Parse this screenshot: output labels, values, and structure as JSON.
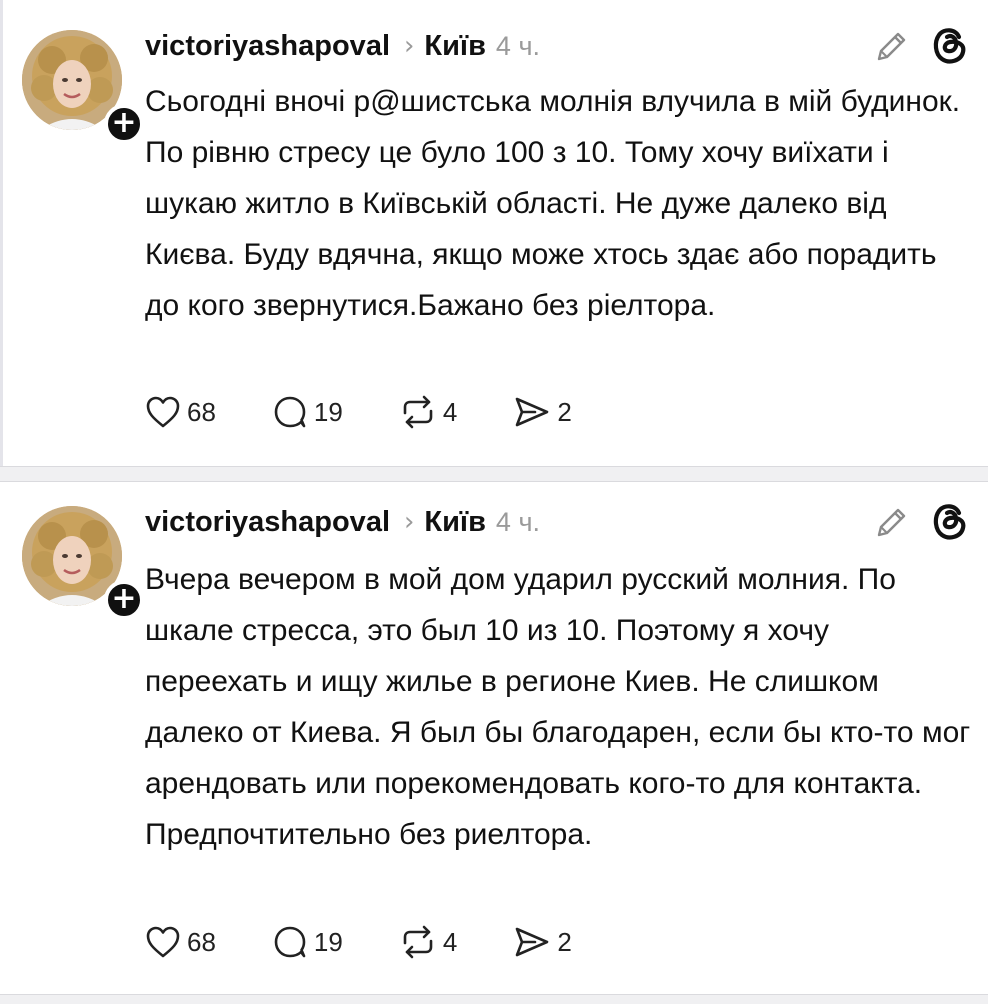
{
  "colors": {
    "text": "#111111",
    "muted": "#9a9a9a",
    "badge": "#101010",
    "separator": "#f0f0f2"
  },
  "posts": [
    {
      "username": "victoriyashapoval",
      "separator_icon": "chevron-right-icon",
      "location": "Київ",
      "time": "4 ч.",
      "text": "Сьогодні вночі р@шистська молнія влучила в мій будинок. По рівню стресу це було 100 з 10. Тому хочу виїхати і шукаю житло в Київській області. Не дуже далеко від Києва. Буду вдячна, якщо може хтось здає або порадить до кого звернутися.Бажано без ріелтора.",
      "badge": "+",
      "actions": {
        "likes": "68",
        "comments": "19",
        "reposts": "4",
        "shares": "2"
      }
    },
    {
      "username": "victoriyashapoval",
      "separator_icon": "chevron-right-icon",
      "location": "Київ",
      "time": "4 ч.",
      "text": "Вчера вечером в мой дом ударил русский молния. По шкале стресса, это был 10 из 10. Поэтому я хочу переехать и ищу жилье в регионе Киев. Не слишком далеко от Киева. Я был бы благодарен, если бы кто-то мог арендовать или порекомендовать кого-то для контакта. Предпочтительно без риелтора.",
      "badge": "+",
      "actions": {
        "likes": "68",
        "comments": "19",
        "reposts": "4",
        "shares": "2"
      }
    }
  ]
}
